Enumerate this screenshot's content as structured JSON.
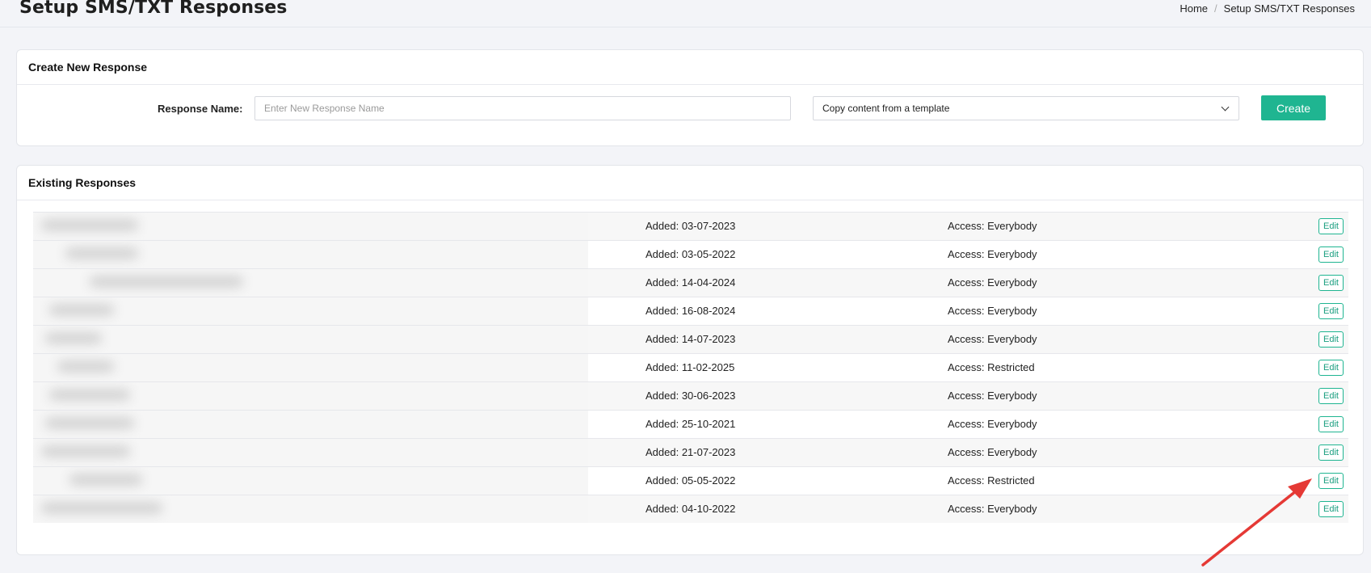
{
  "header": {
    "title": "Setup SMS/TXT Responses",
    "breadcrumb": {
      "home": "Home",
      "separator": "/",
      "current": "Setup SMS/TXT Responses"
    }
  },
  "create_card": {
    "title": "Create New Response",
    "response_name_label": "Response Name:",
    "response_name_placeholder": "Enter New Response Name",
    "response_name_value": "",
    "template_select_value": "Copy content from a template",
    "create_label": "Create"
  },
  "existing_card": {
    "title": "Existing Responses",
    "edit_label": "Edit",
    "rows": [
      {
        "added": "Added: 03-07-2023",
        "access": "Access: Everybody"
      },
      {
        "added": "Added: 03-05-2022",
        "access": "Access: Everybody"
      },
      {
        "added": "Added: 14-04-2024",
        "access": "Access: Everybody"
      },
      {
        "added": "Added: 16-08-2024",
        "access": "Access: Everybody"
      },
      {
        "added": "Added: 14-07-2023",
        "access": "Access: Everybody"
      },
      {
        "added": "Added: 11-02-2025",
        "access": "Access: Restricted"
      },
      {
        "added": "Added: 30-06-2023",
        "access": "Access: Everybody"
      },
      {
        "added": "Added: 25-10-2021",
        "access": "Access: Everybody"
      },
      {
        "added": "Added: 21-07-2023",
        "access": "Access: Everybody"
      },
      {
        "added": "Added: 05-05-2022",
        "access": "Access: Restricted"
      },
      {
        "added": "Added: 04-10-2022",
        "access": "Access: Everybody"
      }
    ]
  },
  "colors": {
    "accent": "#1fb591",
    "annotation_arrow": "#e53935",
    "background": "#f3f4f8"
  },
  "icons": {
    "select_chevron": "chevron-down-icon",
    "annotation": "arrow-annotation-icon"
  }
}
